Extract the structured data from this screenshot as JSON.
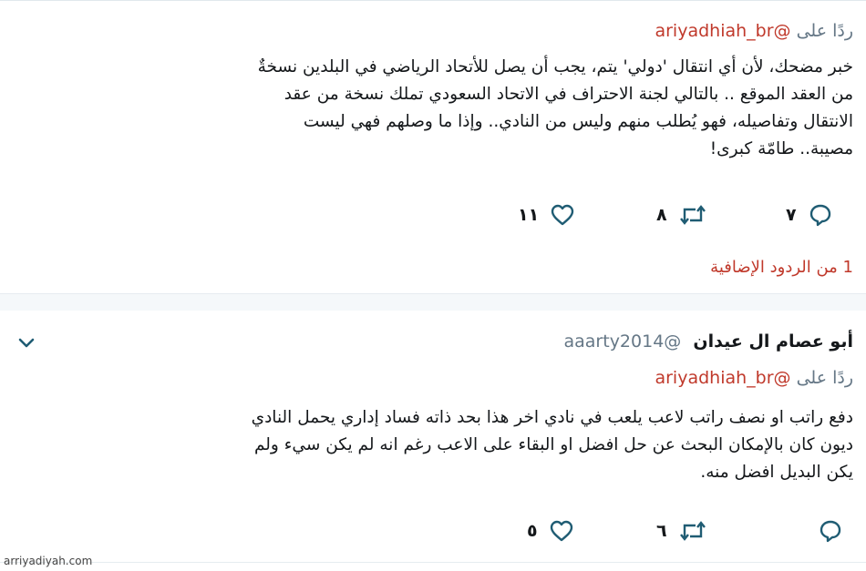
{
  "tweet1": {
    "reply_prefix": "ردًا على",
    "reply_mention": "@ariyadhiah_br",
    "lines": [
      "خبر مضحك، لأن أي انتقال 'دولي' يتم، يجب أن يصل للأتحاد الرياضي في البلدين نسخةٌ",
      "من العقد الموقع .. بالتالي لجنة الاحتراف في الاتحاد السعودي تملك نسخة من عقد",
      "الانتقال وتفاصيله، فهو يُطلب منهم وليس من النادي.. وإذا ما وصلهم فهي ليست",
      "مصيبة.. طامّة كبرى!"
    ],
    "reply_count": "٧",
    "retweet_count": "٨",
    "like_count": "١١"
  },
  "more_replies": "1 من الردود الإضافية",
  "tweet2": {
    "name": "أبو عصام ال عيدان",
    "handle": "@aaarty2014",
    "reply_prefix": "ردًا على",
    "reply_mention": "@ariyadhiah_br",
    "lines": [
      "دفع راتب او نصف راتب لاعب يلعب في نادي اخر هذا بحد ذاته فساد إداري يحمل النادي",
      "ديون كان بالإمكان البحث عن حل افضل او البقاء على الاعب رغم انه لم يكن سيء ولم",
      "يكن البديل افضل منه."
    ],
    "retweet_count": "٦",
    "like_count": "٥"
  },
  "watermark": "arriyadiyah.com",
  "colors": {
    "mention": "#c0392b",
    "icon": "#1f5c73",
    "muted": "#657786"
  }
}
